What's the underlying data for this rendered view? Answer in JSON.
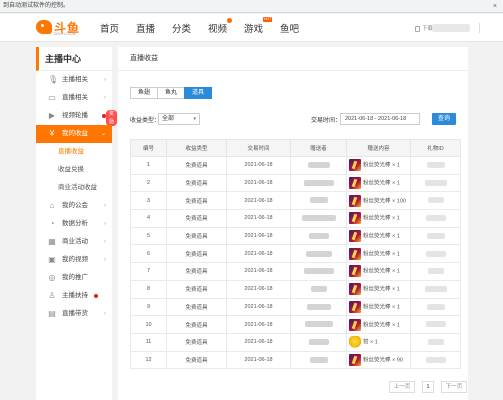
{
  "automation_bar": {
    "message": "到自动测试软件的控制。",
    "close": "×"
  },
  "logo": {
    "text": "斗鱼",
    "sub": "DOUYU.COM"
  },
  "nav": {
    "items": [
      "首页",
      "直播",
      "分类",
      "视频",
      "游戏",
      "鱼吧"
    ],
    "hot_badge": "HOT",
    "download": "下载"
  },
  "sidebar": {
    "title": "主播中心",
    "items": [
      {
        "label": "主播相关",
        "icon": "mic-icon"
      },
      {
        "label": "直播相关",
        "icon": "monitor-icon"
      },
      {
        "label": "视频轮播",
        "icon": "video-icon",
        "badge": "奖励"
      },
      {
        "label": "我的收益",
        "icon": "wallet-icon",
        "active": true
      }
    ],
    "sub_items": [
      {
        "label": "直播收益",
        "active": true
      },
      {
        "label": "收益兑换"
      },
      {
        "label": "商业活动收益"
      }
    ],
    "items_after": [
      {
        "label": "我的公会",
        "icon": "guild-icon"
      },
      {
        "label": "数据分析",
        "icon": "chart-icon"
      },
      {
        "label": "商业活动",
        "icon": "activity-icon"
      },
      {
        "label": "我的视频",
        "icon": "film-icon"
      },
      {
        "label": "我的推广",
        "icon": "promo-icon"
      },
      {
        "label": "主播扶持",
        "icon": "support-icon"
      },
      {
        "label": "直播带货",
        "icon": "shop-icon"
      }
    ]
  },
  "main": {
    "header": "直播收益",
    "tabs": [
      {
        "label": "鱼翅"
      },
      {
        "label": "鱼丸"
      },
      {
        "label": "道具",
        "active": true
      }
    ],
    "filters": {
      "type_label": "收益类型：",
      "type_value": "全部",
      "time_label": "交易时间：",
      "date_range": "2021-06-18 - 2021-06-18",
      "query_button": "查询"
    },
    "table": {
      "columns": [
        "编号",
        "收益类型",
        "交易时间",
        "赠送者",
        "赠送内容",
        "礼物ID"
      ],
      "rows": [
        {
          "no": "1",
          "type": "免费道具",
          "time": "2021-06-18",
          "gift": "粉丝荧光棒 × 1",
          "icon": "glowstick"
        },
        {
          "no": "2",
          "type": "免费道具",
          "time": "2021-06-18",
          "gift": "粉丝荧光棒 × 1",
          "icon": "glowstick"
        },
        {
          "no": "3",
          "type": "免费道具",
          "time": "2021-06-18",
          "gift": "粉丝荧光棒 × 100",
          "icon": "glowstick"
        },
        {
          "no": "4",
          "type": "免费道具",
          "time": "2021-06-18",
          "gift": "粉丝荧光棒 × 1",
          "icon": "glowstick"
        },
        {
          "no": "5",
          "type": "免费道具",
          "time": "2021-06-18",
          "gift": "粉丝荧光棒 × 1",
          "icon": "glowstick"
        },
        {
          "no": "6",
          "type": "免费道具",
          "time": "2021-06-18",
          "gift": "粉丝荧光棒 × 1",
          "icon": "glowstick"
        },
        {
          "no": "7",
          "type": "免费道具",
          "time": "2021-06-18",
          "gift": "粉丝荧光棒 × 1",
          "icon": "glowstick"
        },
        {
          "no": "8",
          "type": "免费道具",
          "time": "2021-06-18",
          "gift": "粉丝荧光棒 × 1",
          "icon": "glowstick"
        },
        {
          "no": "9",
          "type": "免费道具",
          "time": "2021-06-18",
          "gift": "粉丝荧光棒 × 1",
          "icon": "glowstick"
        },
        {
          "no": "10",
          "type": "免费道具",
          "time": "2021-06-18",
          "gift": "粉丝荧光棒 × 1",
          "icon": "glowstick"
        },
        {
          "no": "11",
          "type": "免费道具",
          "time": "2021-06-18",
          "gift": "赞 × 1",
          "icon": "like"
        },
        {
          "no": "12",
          "type": "免费道具",
          "time": "2021-06-18",
          "gift": "粉丝荧光棒 × 90",
          "icon": "glowstick"
        }
      ]
    },
    "pager": {
      "prev": "上一页",
      "current": "1",
      "next": "下一页"
    }
  }
}
